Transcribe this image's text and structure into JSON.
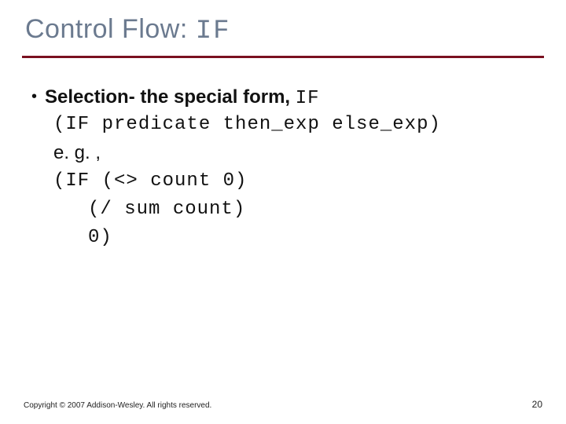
{
  "title_prefix": "Control Flow: ",
  "title_code": "IF",
  "bullet_prefix": "Selection- the special form, ",
  "bullet_code": "IF",
  "code1": "(IF predicate then_exp else_exp)",
  "eg": "e. g. ,",
  "code2": "(IF (<> count 0)",
  "code3": "(/ sum count)",
  "code4": "0)",
  "copyright": "Copyright © 2007 Addison-Wesley. All rights reserved.",
  "page": "20"
}
